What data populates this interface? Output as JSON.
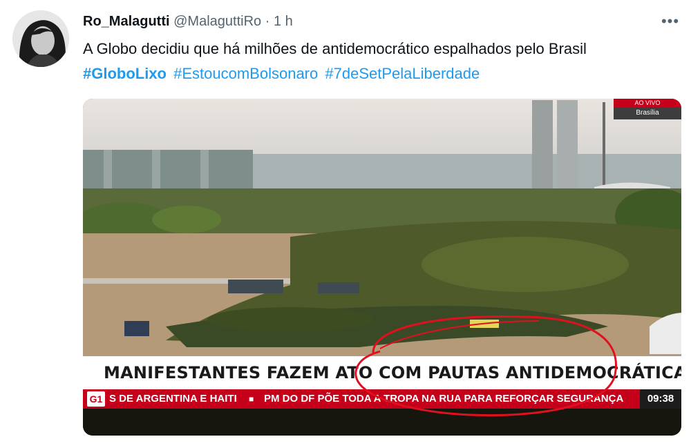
{
  "tweet": {
    "display_name": "Ro_Malagutti",
    "handle": "@MalaguttiRo",
    "separator": "·",
    "time": "1 h",
    "more_icon": "more-horizontal-icon",
    "more_label": "•••",
    "text": "A Globo decidiu que há milhões de antidemocrático espalhados pelo Brasil",
    "hashtags": [
      "#GloboLixo",
      "#EstoucomBolsonaro",
      "#7deSetPelaLiberdade"
    ]
  },
  "media": {
    "live_badge_top": "AO VIVO",
    "live_badge_location": "Brasília",
    "headline": "MANIFESTANTES FAZEM ATO COM PAUTAS ANTIDEMOCRÁTICAS EM BRASÍLIA",
    "ticker_logo": "G1",
    "ticker_text_1": "S DE ARGENTINA E HAITI",
    "ticker_bullet": "■",
    "ticker_text_2": "PM DO DF PÕE TODA A TROPA NA RUA PARA REFORÇAR SEGURANÇA",
    "clock": "09:38",
    "annotation_color": "#e0101e"
  },
  "colors": {
    "link": "#1d9bf0",
    "text": "#0f1419",
    "muted": "#536471",
    "globo_red": "#c4001a"
  }
}
